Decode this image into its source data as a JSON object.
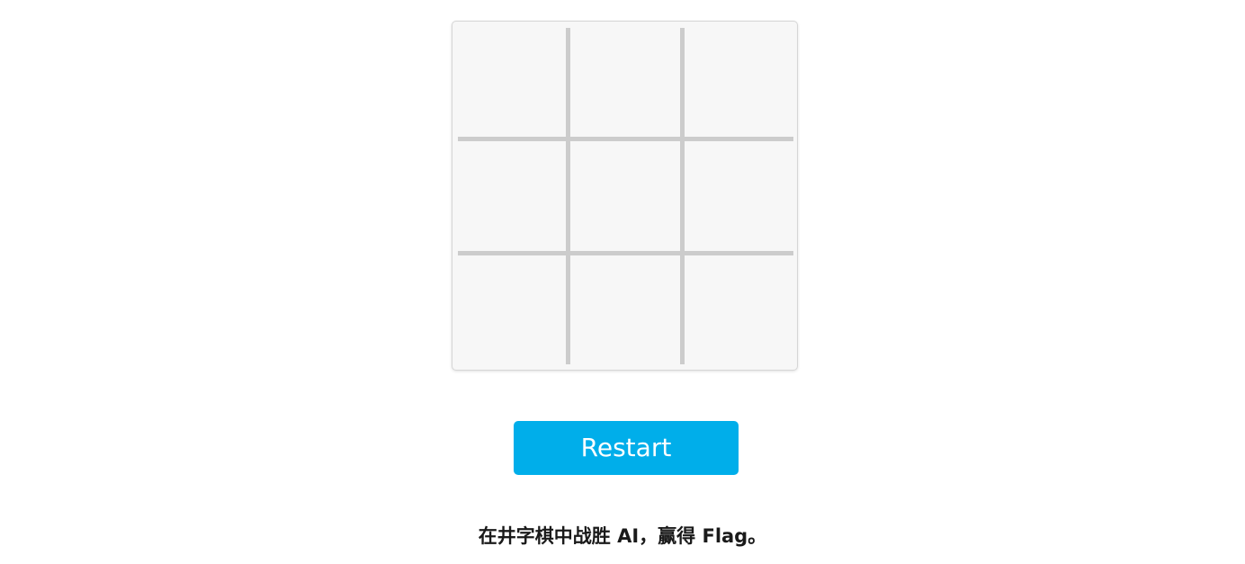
{
  "game": {
    "type": "tic-tac-toe",
    "cells": [
      "",
      "",
      "",
      "",
      "",
      "",
      "",
      "",
      ""
    ]
  },
  "restart_label": "Restart",
  "message": "在井字棋中战胜 AI，赢得 Flag。",
  "colors": {
    "board_bg": "#f7f7f7",
    "grid_line": "#cccccc",
    "button_bg": "#00aeea",
    "button_text": "#ffffff"
  }
}
